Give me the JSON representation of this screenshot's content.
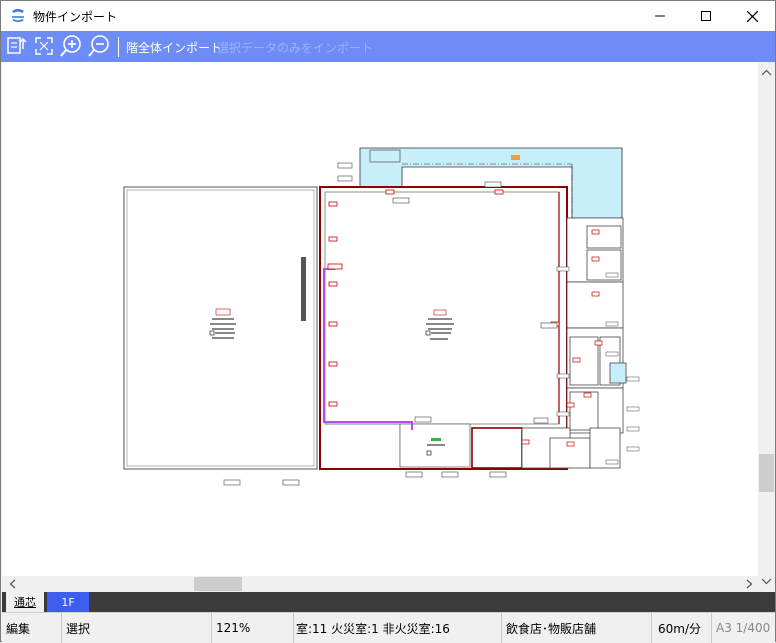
{
  "window": {
    "title": "物件インポート"
  },
  "toolbar": {
    "import_floor_label": "階全体インポート",
    "import_selected_label": "選択データのみをインポート",
    "icons": [
      "import-icon",
      "fit-icon",
      "zoom-in-icon",
      "zoom-out-icon"
    ]
  },
  "tabs": [
    {
      "label": "通芯"
    },
    {
      "label": "1F"
    }
  ],
  "status": {
    "mode": "編集",
    "tool": "選択",
    "zoom": "121%",
    "rooms": "室:11 火災室:1 非火災室:16",
    "use": "飲食店･物販店舗",
    "speed": "60m/分",
    "paper": "A3 1/400"
  },
  "colors": {
    "toolbar_bg": "#6d8cf5",
    "tab_active_bg": "#3d5df0",
    "wall_red": "#8b0000",
    "route_purple": "#b44cf0",
    "water_blue": "#c8eefb"
  }
}
